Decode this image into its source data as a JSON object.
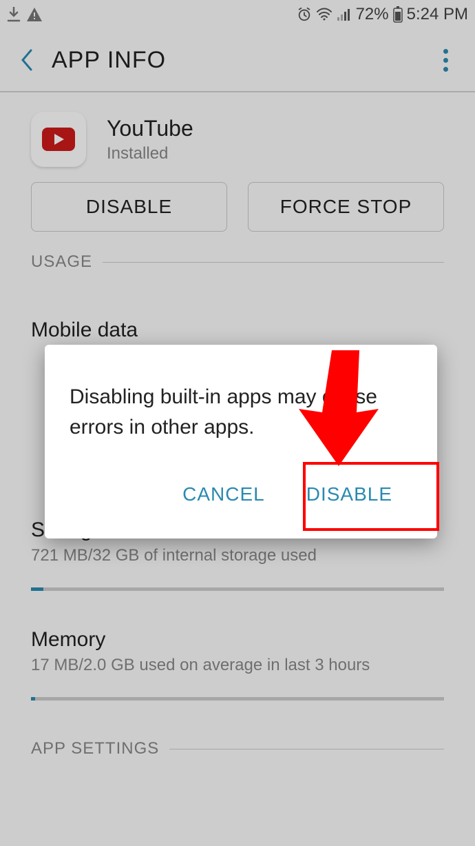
{
  "status": {
    "battery_text": "72%",
    "time_text": "5:24 PM"
  },
  "header": {
    "title": "APP INFO"
  },
  "app": {
    "name": "YouTube",
    "status": "Installed"
  },
  "buttons": {
    "disable": "DISABLE",
    "force_stop": "FORCE STOP"
  },
  "sections": {
    "usage": "USAGE",
    "app_settings": "APP SETTINGS"
  },
  "items": {
    "mobile_data": {
      "title": "Mobile data"
    },
    "storage": {
      "title": "Storage",
      "sub": "721 MB/32 GB of internal storage used",
      "progress_pct": 3
    },
    "memory": {
      "title": "Memory",
      "sub": "17 MB/2.0 GB used on average in last 3 hours"
    }
  },
  "dialog": {
    "message_l1": "Disabling built-in apps may cause",
    "message_l2": "errors in other apps.",
    "cancel": "CANCEL",
    "disable": "DISABLE"
  }
}
